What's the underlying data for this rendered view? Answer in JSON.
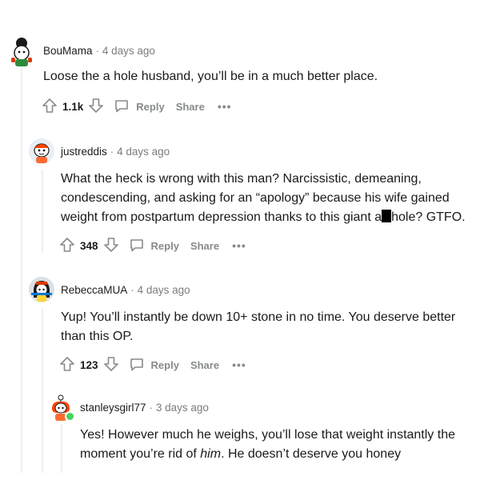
{
  "comments": [
    {
      "author": "BouMama",
      "time": "4 days ago",
      "body": "Loose the a hole husband, you’ll be in a much better place.",
      "score": "1.1k",
      "reply_label": "Reply",
      "share_label": "Share",
      "more_label": "•••"
    },
    {
      "author": "justreddis",
      "time": "4 days ago",
      "body_line1": "What the heck is wrong with this man? Narcissistic, demeaning,",
      "body_line2": "condescending, and asking for an “apology” because his wife gained",
      "body_line3_pre": "weight from postpartum depression thanks to this giant a",
      "body_line3_post": "hole? GTFO.",
      "score": "348",
      "reply_label": "Reply",
      "share_label": "Share",
      "more_label": "•••"
    },
    {
      "author": "RebeccaMUA",
      "time": "4 days ago",
      "body_line1": "Yup! You’ll instantly be down 10+ stone in no time. You deserve better",
      "body_line2": "than this OP.",
      "score": "123",
      "reply_label": "Reply",
      "share_label": "Share",
      "more_label": "•••"
    },
    {
      "author": "stanleysgirl77",
      "time": "3 days ago",
      "body_line1": "Yes! However much he weighs, you’ll lose that weight instantly the",
      "body_line2_pre": "moment you’re rid of ",
      "body_line2_em": "him",
      "body_line2_post": ". He doesn’t deserve you honey"
    }
  ],
  "separator": "·",
  "icons": [
    "upvote-icon",
    "downvote-icon",
    "comment-bubble-icon"
  ]
}
